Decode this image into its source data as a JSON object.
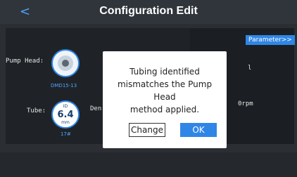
{
  "header": {
    "title": "Configuration Edit",
    "back_label": "<"
  },
  "params": {
    "button_label": "Parameter>>",
    "value1": "l",
    "value2": "0rpm"
  },
  "pump": {
    "label": "Pump Head:",
    "model": "DMD15-13"
  },
  "tube": {
    "label": "Tube:",
    "id_label": "ID",
    "value": "6.4",
    "unit": "mm",
    "number": "17#"
  },
  "den": {
    "label": "Den"
  },
  "dialog": {
    "message_line1": "Tubing identified",
    "message_line2": "mismatches the Pump Head",
    "message_line3": "method applied.",
    "change_label": "Change",
    "ok_label": "OK"
  }
}
